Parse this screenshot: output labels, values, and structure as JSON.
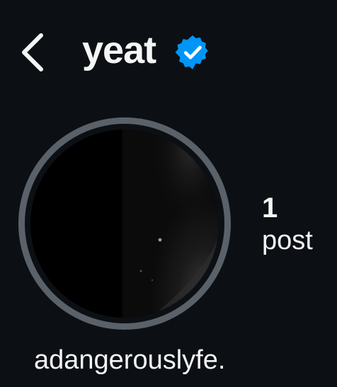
{
  "header": {
    "username": "yeat",
    "back_icon": "chevron-left-icon",
    "verified_icon": "verified-badge-icon",
    "verified_color": "#0095f6"
  },
  "profile": {
    "avatar_ring_color": "#5b6169",
    "stats": {
      "posts_count": "1",
      "posts_label": "post"
    },
    "display_name": "adangerouslyfe."
  },
  "colors": {
    "background": "#0c1014",
    "text": "#f5f5f5"
  }
}
